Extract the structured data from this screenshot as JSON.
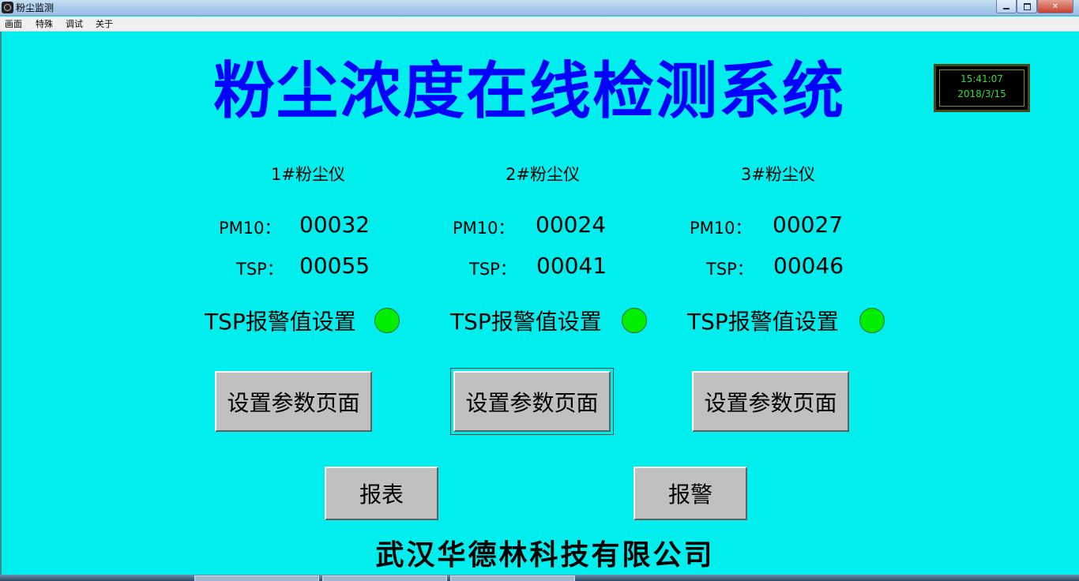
{
  "window": {
    "title": "粉尘监测",
    "icon": "app-icon"
  },
  "menu": [
    "画面",
    "特殊",
    "调试",
    "关于"
  ],
  "header": {
    "title": "粉尘浓度在线检测系统"
  },
  "clock": {
    "time": "15:41:07",
    "date": "2018/3/15",
    "color": "#33dd33"
  },
  "devices": [
    {
      "name": "1#粉尘仪",
      "pm10_label": "PM10：",
      "pm10": "00032",
      "tsp_label": "TSP：",
      "tsp": "00055",
      "alarm_label": "TSP报警值设置",
      "alarm_status": "normal",
      "button": "设置参数页面"
    },
    {
      "name": "2#粉尘仪",
      "pm10_label": "PM10：",
      "pm10": "00024",
      "tsp_label": "TSP：",
      "tsp": "00041",
      "alarm_label": "TSP报警值设置",
      "alarm_status": "normal",
      "button": "设置参数页面"
    },
    {
      "name": "3#粉尘仪",
      "pm10_label": "PM10：",
      "pm10": "00027",
      "tsp_label": "TSP：",
      "tsp": "00046",
      "alarm_label": "TSP报警值设置",
      "alarm_status": "normal",
      "button": "设置参数页面"
    }
  ],
  "actions": {
    "report": "报表",
    "alarm": "报警"
  },
  "footer": {
    "company": "武汉华德林科技有限公司"
  },
  "colors": {
    "background": "#00eeee",
    "title": "#0000ff",
    "led_ok": "#00ee00"
  }
}
